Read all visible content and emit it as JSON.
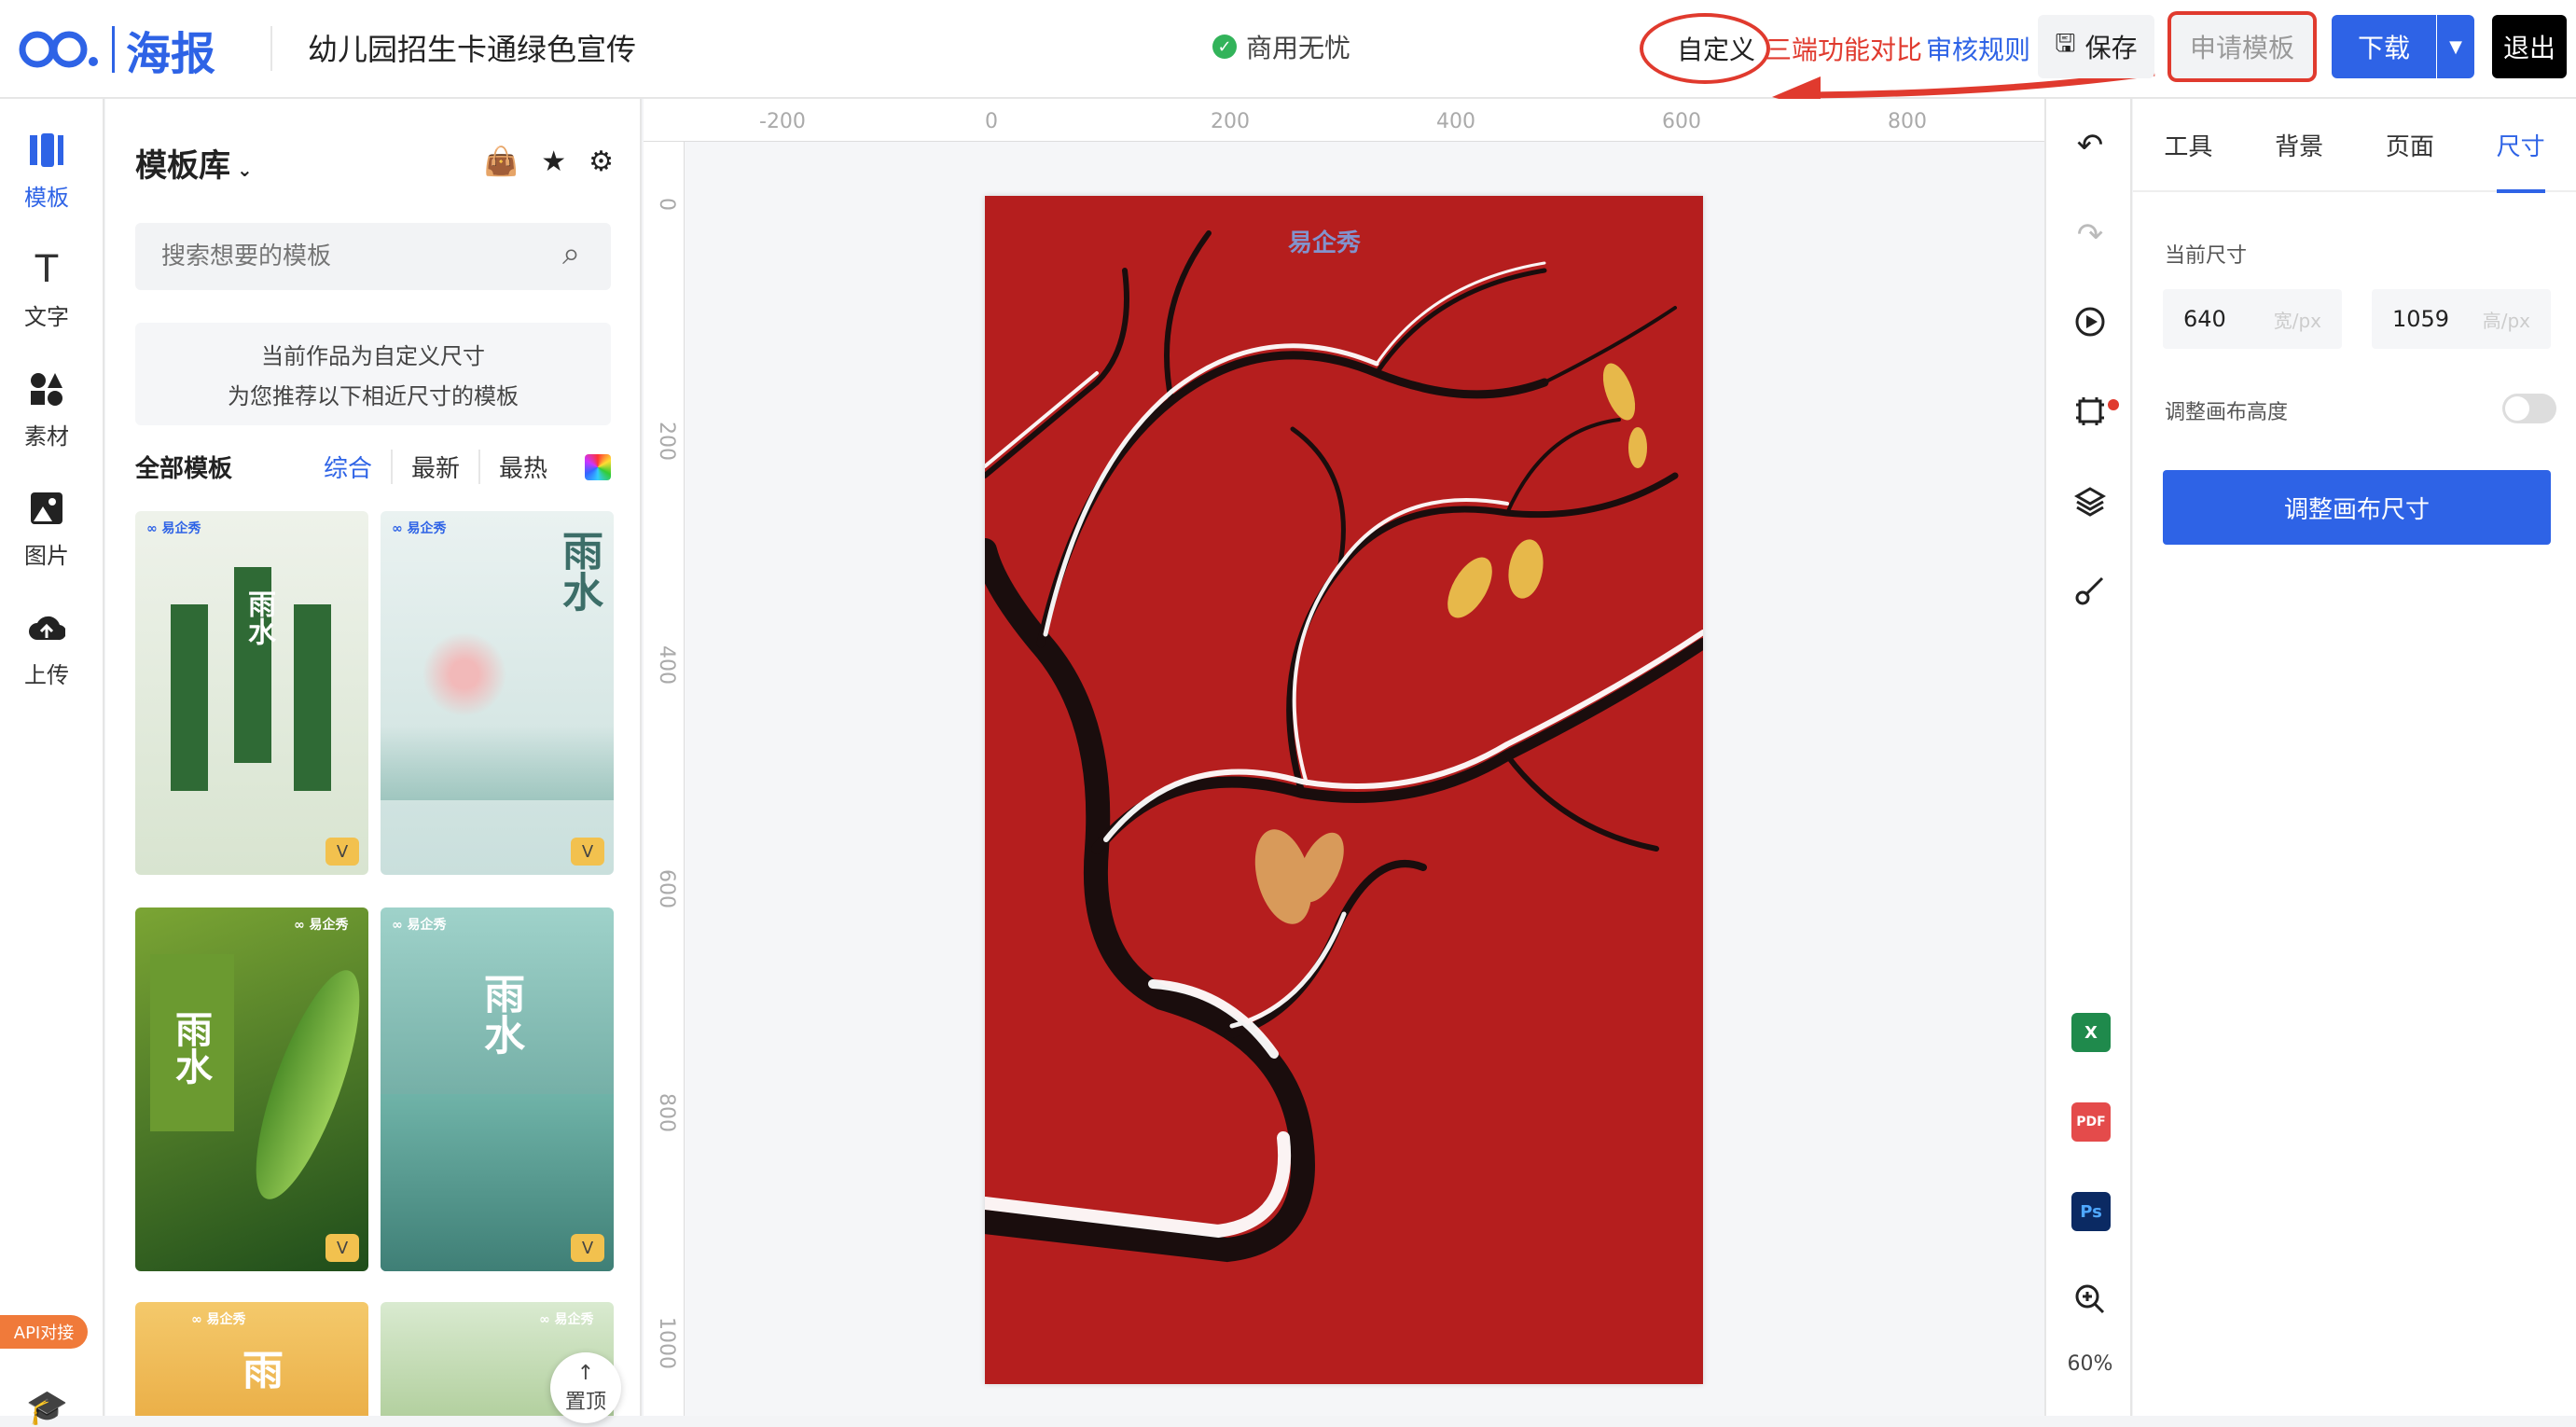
{
  "topbar": {
    "logo_text": "海报",
    "doc_title": "幼儿园招生卡通绿色宣传",
    "commercial": "商用无忧",
    "custom": "自定义",
    "compare": "三端功能对比",
    "rules": "审核规则",
    "save": "保存",
    "apply_template": "申请模板",
    "download": "下载",
    "exit": "退出"
  },
  "leftrail": {
    "items": [
      {
        "label": "模板",
        "icon": "template-icon"
      },
      {
        "label": "文字",
        "icon": "text-icon"
      },
      {
        "label": "素材",
        "icon": "material-icon"
      },
      {
        "label": "图片",
        "icon": "image-icon"
      },
      {
        "label": "上传",
        "icon": "upload-icon"
      }
    ],
    "api_badge": "API对接"
  },
  "panel": {
    "title": "模板库",
    "search_placeholder": "搜索想要的模板",
    "notice_line1": "当前作品为自定义尺寸",
    "notice_line2": "为您推荐以下相近尺寸的模板",
    "all_label": "全部模板",
    "tabs": [
      "综合",
      "最新",
      "最热"
    ],
    "thumbs": [
      {
        "word": "雨水"
      },
      {
        "word": "雨水"
      },
      {
        "word": "雨水"
      },
      {
        "word": "雨水"
      },
      {
        "word": "雨"
      },
      {
        "word": ""
      }
    ],
    "back_to_top": "置顶"
  },
  "canvas": {
    "ruler_h": [
      "-200",
      "0",
      "200",
      "400",
      "600",
      "800"
    ],
    "ruler_v": [
      "0",
      "200",
      "400",
      "600",
      "800",
      "1000"
    ],
    "art_logo": "易企秀",
    "bg_color": "#b51e1e"
  },
  "toolbar": {
    "zoom": "60%",
    "apps": [
      "X",
      "PDF",
      "Ps"
    ]
  },
  "rpanel": {
    "tabs": [
      "工具",
      "背景",
      "页面",
      "尺寸"
    ],
    "active_tab": "尺寸",
    "current_size_label": "当前尺寸",
    "width": "640",
    "width_unit": "宽/px",
    "height": "1059",
    "height_unit": "高/px",
    "adjust_height_label": "调整画布高度",
    "adjust_size_button": "调整画布尺寸"
  }
}
